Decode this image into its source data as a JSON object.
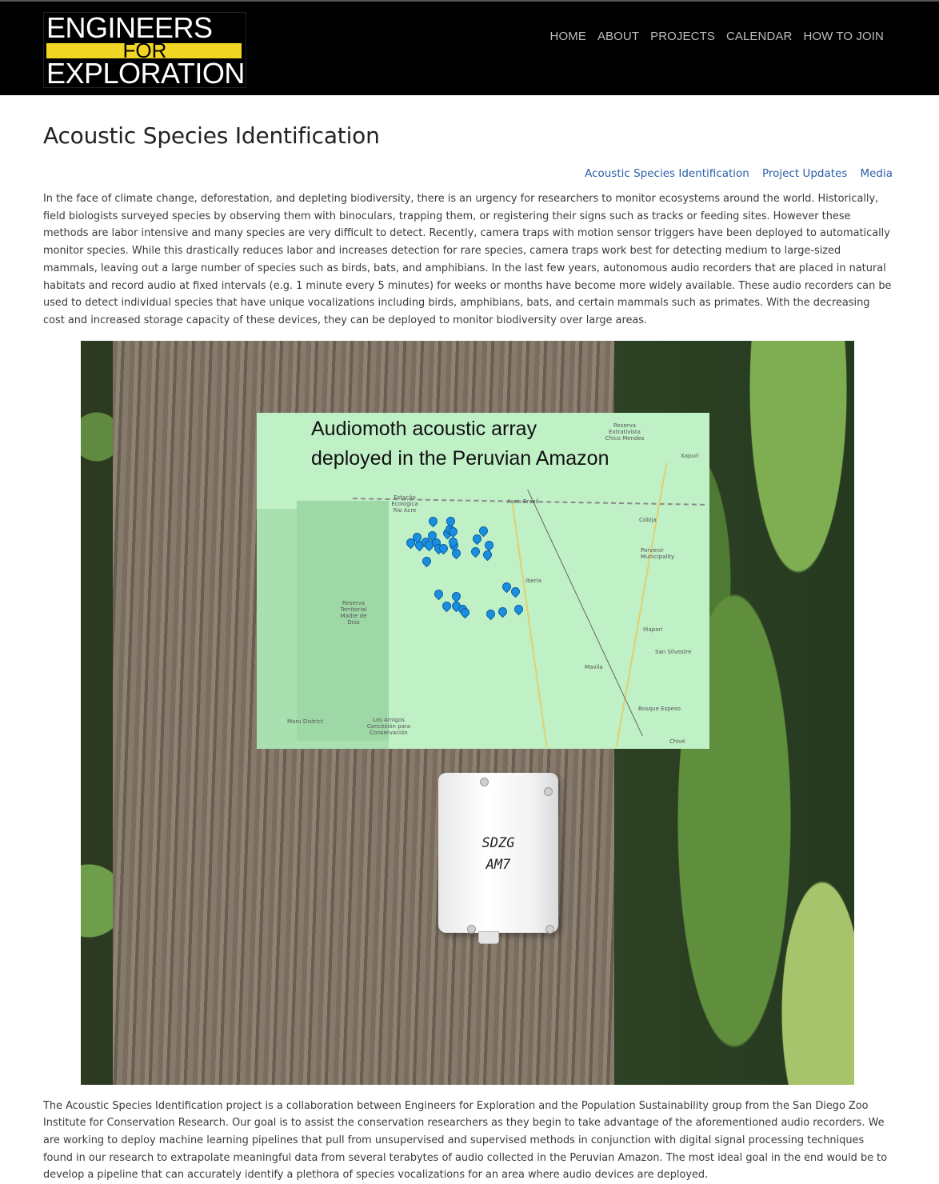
{
  "header": {
    "logo": {
      "line1": "ENGINEERS",
      "line2": "FOR",
      "line3": "EXPLORATION"
    },
    "nav": [
      "HOME",
      "ABOUT",
      "PROJECTS",
      "CALENDAR",
      "HOW TO JOIN"
    ]
  },
  "page": {
    "title": "Acoustic Species Identification",
    "subnav": [
      "Acoustic Species Identification",
      "Project Updates",
      "Media"
    ],
    "intro": "In the face of climate change, deforestation, and depleting biodiversity, there is an urgency for researchers to monitor ecosystems around the world. Historically, field biologists surveyed species by observing them with binoculars, trapping them, or registering their signs such as tracks or feeding sites. However these methods are labor intensive and many species are very difficult to detect. Recently, camera traps with motion sensor triggers have been deployed to automatically monitor species. While this drastically reduces labor and increases detection for rare species, camera traps work best for detecting medium to large-sized mammals, leaving out a large number of species such as birds, bats, and amphibians. In the last few years, autonomous audio recorders that are placed in natural habitats and record audio at fixed intervals (e.g. 1 minute every 5 minutes) for weeks or months have become more widely available. These audio recorders can be used to detect individual species that have unique vocalizations including birds, amphibians, bats, and certain mammals such as primates. With the decreasing cost and increased storage capacity of these devices, they can be deployed to monitor biodiversity over large areas.",
    "collaboration": "The Acoustic Species Identification project is a collaboration between Engineers for Exploration and the Population Sustainability group from the San Diego Zoo Institute for Conservation Research. Our goal is to assist the conservation researchers as they begin to take advantage of the aforementioned audio recorders. We are working to deploy machine learning pipelines that pull from unsupervised and supervised methods in conjunction with digital signal processing techniques found in our research to extrapolate meaningful data from several terabytes of audio collected in the Peruvian Amazon. The most ideal goal in the end would be to develop a pipeline that can accurately identify a plethora of species vocalizations for an area where audio devices are deployed."
  },
  "figure": {
    "map_title_line1": "Audiomoth acoustic array",
    "map_title_line2": "deployed in the Peruvian Amazon",
    "map_labels": [
      "Reserva Extrativista Chico Mendes",
      "Xapuri",
      "Estação Ecologica Rio Acre",
      "Assis Brasil",
      "Cobija",
      "Porvenir Municipality",
      "Iberia",
      "Reserva Territorial Madre de Dios",
      "Iñapari",
      "San Silvestre",
      "Mavila",
      "Bosque Espeso",
      "Maru District",
      "Los Amigos Concesión para Conservación",
      "Chivé"
    ],
    "device_label_line1": "SDZG",
    "device_label_line2": "AM7",
    "colors": {
      "pin": "#1a8fe0",
      "map": "#bff0c6",
      "logo_yellow": "#f1d625"
    }
  }
}
